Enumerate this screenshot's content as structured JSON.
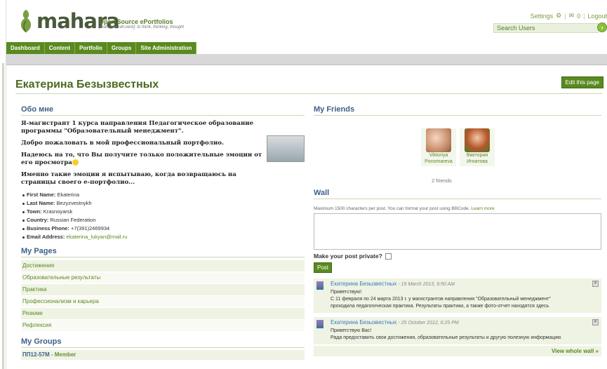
{
  "header": {
    "brand": "mahara",
    "tagline_title": "Open Source ePortfolios",
    "tagline_sub": "[mah-hah-rah;verb]: to think, thinking, thought",
    "settings_label": "Settings",
    "inbox_count": "0",
    "logout_label": "Logout",
    "search_placeholder": "Search Users"
  },
  "nav": {
    "items": [
      "Dashboard",
      "Content",
      "Portfolio",
      "Groups",
      "Site Administration"
    ]
  },
  "page": {
    "title": "Екатерина Безызвестных",
    "edit_button": "Edit this page"
  },
  "about": {
    "heading": "Обо мне",
    "p1": "Я-магистрант 1 курса направления Педагогическое образование программы \"Образовательный менеджмент\".",
    "p2": "Добро пожаловать в мой профессиональный портфолио.",
    "p3": "Надеюсь на то, что Вы получите только положительные эмоции от его просмотра",
    "p4": "Именно такие эмоции я испытываю, когда возвращаюсь на страницы своего е-портфолио...",
    "facts": [
      {
        "label": "First Name:",
        "value": "Ekaterina"
      },
      {
        "label": "Last Name:",
        "value": "Bezyzvestnykh"
      },
      {
        "label": "Town:",
        "value": "Krasnoyarsk"
      },
      {
        "label": "Country:",
        "value": "Russian Federation"
      },
      {
        "label": "Business Phone:",
        "value": "+7(391)2469934"
      },
      {
        "label": "Email Address:",
        "value": "ekaterina_lukyan@mail.ru"
      }
    ]
  },
  "my_pages": {
    "heading": "My Pages",
    "items": [
      "Достижения",
      "Образовательные результаты",
      "Практика",
      "Профессионализм и карьера",
      "Резюме",
      "Рефлексия"
    ]
  },
  "my_groups": {
    "heading": "My Groups",
    "group_name": "ПП12-57М",
    "group_role": " - Member"
  },
  "friends": {
    "heading": "My Friends",
    "list": [
      {
        "name1": "Viktoriya",
        "name2": "Ponomareva"
      },
      {
        "name1": "Виктория",
        "name2": "Игнатова"
      }
    ],
    "count": "2 friends"
  },
  "wall": {
    "heading": "Wall",
    "note": "Maximum 1500 characters per post. You can format your post using BBCode.",
    "learn_more": "Learn more",
    "private_label": "Make your post private?",
    "post_button": "Post",
    "posts": [
      {
        "author": "Екатерина Безызвестных",
        "date": " - 19 March 2013, 9:50 AM",
        "line1": "Приветствую!",
        "line2": "С 11 февраля по 24 марта 2013 г. у магистрантов направления \"Образовательный менеджмент\"",
        "line3": "проходила педагогическая практика. Результаты практики, а также фото-отчет находятся здесь"
      },
      {
        "author": "Екатерина Безызвестных",
        "date": " - 25 October 2012, 6:25 PM",
        "line1": "Приветствую Вас!",
        "line2": "Рада предоставить свои достижения, образовательные результаты и другую полезную информацию",
        "line3": ""
      }
    ],
    "view_whole": "View whole wall »"
  },
  "colors": {
    "brand_green": "#5a8a1f",
    "heading_blue": "#3d5f88",
    "link_blue": "#3d7bb4"
  }
}
